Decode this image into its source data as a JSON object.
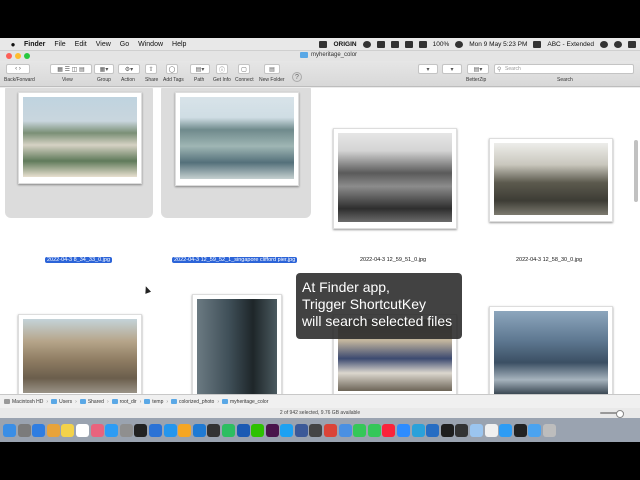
{
  "menubar": {
    "apple": "",
    "app_name": "Finder",
    "items": [
      "File",
      "Edit",
      "View",
      "Go",
      "Window",
      "Help"
    ],
    "status": {
      "origin": "ORIGIN",
      "battery": "100%",
      "datetime": "Mon 9 May  5:23 PM",
      "input_source": "ABC - Extended"
    }
  },
  "window": {
    "title": "myheritage_color"
  },
  "toolbar": {
    "labels": [
      "Back/Forward",
      "View",
      "Group",
      "Action",
      "Share",
      "Add Tags",
      "Path",
      "Get Info",
      "Connect",
      "New Folder",
      "BetterZip",
      "Search"
    ],
    "search_placeholder": "Search",
    "help": "?"
  },
  "files": [
    {
      "name": "2022-04-3 8_34_33_0.jpg",
      "selected": true
    },
    {
      "name": "2022-04-3 12_59_52_1_singapore clifford pier.jpg",
      "selected": true
    },
    {
      "name": "2022-04-3 12_59_51_0.jpg",
      "selected": false
    },
    {
      "name": "2022-04-3 12_58_30_0.jpg",
      "selected": false
    },
    {
      "name": "",
      "selected": false
    },
    {
      "name": "",
      "selected": false
    },
    {
      "name": "",
      "selected": false
    },
    {
      "name": "",
      "selected": false
    }
  ],
  "overlay": {
    "line1": "At Finder app,",
    "line2": "Trigger ShortcutKey",
    "line3": "will search selected files"
  },
  "pathbar": [
    "Macintosh HD",
    "Users",
    "Shared",
    "root_dir",
    "temp",
    "colorized_photo",
    "myheritage_color"
  ],
  "status": {
    "text": "2 of 942 selected, 9.76 GB available"
  },
  "dock": {
    "icons": [
      "finder",
      "launchpad",
      "safari",
      "chrome",
      "notes",
      "calendar",
      "photos",
      "app-store",
      "system-prefs",
      "terminal",
      "xcode",
      "docker",
      "sublime",
      "vscode",
      "iterm",
      "evernote",
      "sourcetree",
      "wechat",
      "slack",
      "twitter",
      "facebook",
      "cb",
      "chrome-2",
      "mail",
      "messages",
      "facetime",
      "music",
      "zoom",
      "telegram",
      "r",
      "code",
      "activity",
      "preview",
      "textedit",
      "appstore-2",
      "terminal-2",
      "folder",
      "trash"
    ],
    "colors": [
      "#3a8ee6",
      "#7b7b7b",
      "#2f7de1",
      "#e8a33a",
      "#f3d24a",
      "#ffffff",
      "#e9637d",
      "#2d9cf4",
      "#8f8f8f",
      "#222222",
      "#2a72d6",
      "#2496ed",
      "#f5a623",
      "#1f7ad3",
      "#333333",
      "#2dbe60",
      "#1b5ab3",
      "#2dc100",
      "#4a154b",
      "#1da1f2",
      "#3b5998",
      "#444444",
      "#db4437",
      "#4a90e2",
      "#35c759",
      "#35c759",
      "#fa233b",
      "#2d8cff",
      "#2aa1da",
      "#276dc3",
      "#1e1e1e",
      "#333333",
      "#9bc5ef",
      "#f0f0f0",
      "#2d9cf4",
      "#222222",
      "#4aa3f0",
      "#bdbdbd"
    ]
  }
}
